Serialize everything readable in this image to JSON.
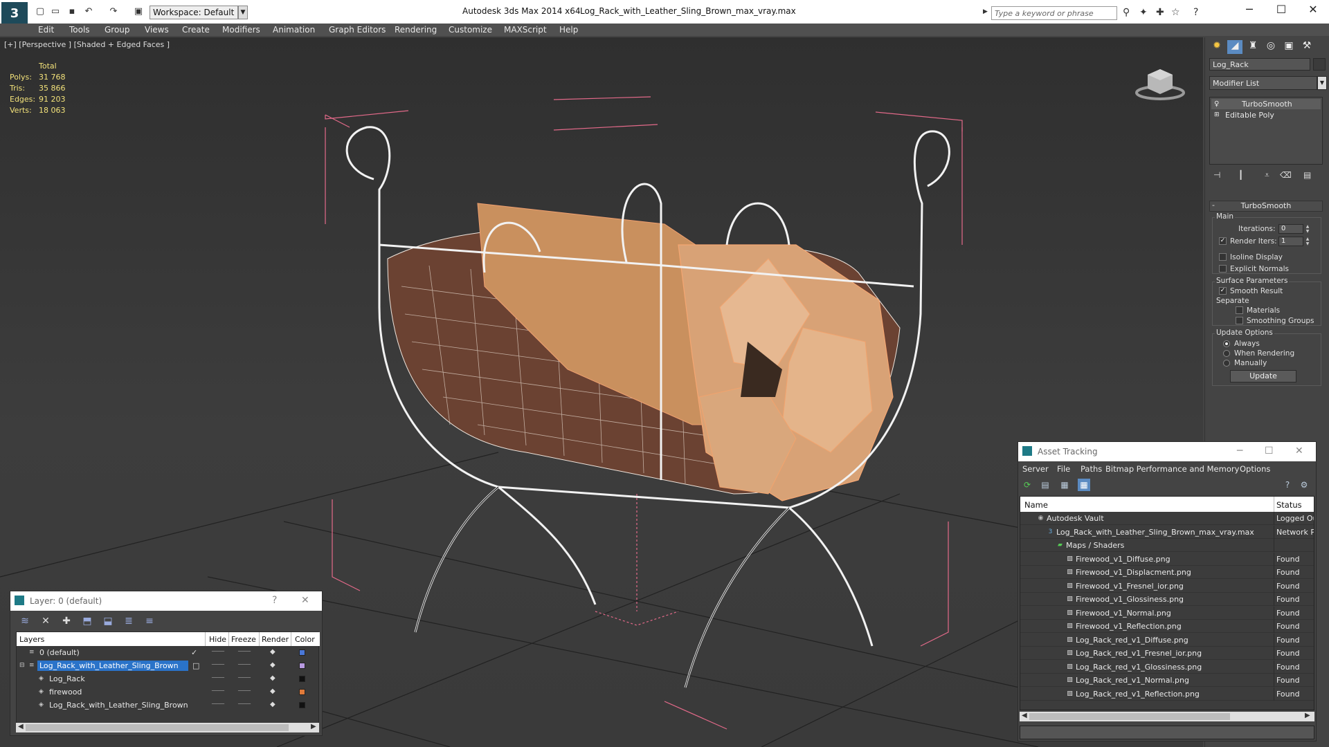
{
  "titlebar": {
    "workspace": "Workspace: Default",
    "app_title": "Autodesk 3ds Max  2014 x64",
    "file_title": "Log_Rack_with_Leather_Sling_Brown_max_vray.max",
    "search_placeholder": "Type a keyword or phrase"
  },
  "menu": [
    "Edit",
    "Tools",
    "Group",
    "Views",
    "Create",
    "Modifiers",
    "Animation",
    "Graph Editors",
    "Rendering",
    "Customize",
    "MAXScript",
    "Help"
  ],
  "viewport": {
    "label": "[+] [Perspective ] [Shaded + Edged Faces ]",
    "stats": {
      "header": "Total",
      "rows": [
        {
          "label": "Polys:",
          "value": "31 768"
        },
        {
          "label": "Tris:",
          "value": "35 866"
        },
        {
          "label": "Edges:",
          "value": "91 203"
        },
        {
          "label": "Verts:",
          "value": "18 063"
        }
      ]
    }
  },
  "command_panel": {
    "object_name": "Log_Rack",
    "modifier_list": "Modifier List",
    "stack": [
      "TurboSmooth",
      "Editable Poly"
    ],
    "rollout_title": "TurboSmooth",
    "main_group": "Main",
    "iterations_label": "Iterations:",
    "iterations_value": "0",
    "render_iters_label": "Render Iters:",
    "render_iters_value": "1",
    "render_iters_checked": true,
    "isoline_label": "Isoline Display",
    "explicit_normals_label": "Explicit Normals",
    "surface_group": "Surface Parameters",
    "smooth_result_label": "Smooth Result",
    "separate_label": "Separate",
    "materials_label": "Materials",
    "smoothing_groups_label": "Smoothing Groups",
    "update_group": "Update Options",
    "always_label": "Always",
    "when_rendering_label": "When Rendering",
    "manually_label": "Manually",
    "update_button": "Update"
  },
  "layer_window": {
    "title": "Layer: 0 (default)",
    "help": "?",
    "headers": {
      "layers": "Layers",
      "hide": "Hide",
      "freeze": "Freeze",
      "render": "Render",
      "color": "Color"
    },
    "rows": [
      {
        "name": "0 (default)",
        "indent": 1,
        "color": "#4a78d8",
        "current": true
      },
      {
        "name": "Log_Rack_with_Leather_Sling_Brown",
        "indent": 1,
        "color": "#b89ae0",
        "selected": true
      },
      {
        "name": "Log_Rack",
        "indent": 2,
        "color": "#111111"
      },
      {
        "name": "firewood",
        "indent": 2,
        "color": "#e07a3a"
      },
      {
        "name": "Log_Rack_with_Leather_Sling_Brown",
        "indent": 2,
        "color": "#111111"
      }
    ]
  },
  "asset_window": {
    "title": "Asset Tracking",
    "menu": [
      "Server",
      "File",
      "Paths",
      "Bitmap Performance and Memory",
      "Options"
    ],
    "headers": {
      "name": "Name",
      "status": "Status"
    },
    "rows": [
      {
        "name": "Autodesk Vault",
        "indent": 1,
        "status": "Logged Ou",
        "icon": "vault-icon"
      },
      {
        "name": "Log_Rack_with_Leather_Sling_Brown_max_vray.max",
        "indent": 2,
        "status": "Network P",
        "icon": "max-file-icon"
      },
      {
        "name": "Maps / Shaders",
        "indent": 3,
        "status": "",
        "icon": "maps-icon"
      },
      {
        "name": "Firewood_v1_Diffuse.png",
        "indent": 4,
        "status": "Found",
        "icon": "bitmap-icon"
      },
      {
        "name": "Firewood_v1_Displacment.png",
        "indent": 4,
        "status": "Found",
        "icon": "bitmap-icon"
      },
      {
        "name": "Firewood_v1_Fresnel_ior.png",
        "indent": 4,
        "status": "Found",
        "icon": "bitmap-icon"
      },
      {
        "name": "Firewood_v1_Glossiness.png",
        "indent": 4,
        "status": "Found",
        "icon": "bitmap-icon"
      },
      {
        "name": "Firewood_v1_Normal.png",
        "indent": 4,
        "status": "Found",
        "icon": "bitmap-icon"
      },
      {
        "name": "Firewood_v1_Reflection.png",
        "indent": 4,
        "status": "Found",
        "icon": "bitmap-icon"
      },
      {
        "name": "Log_Rack_red_v1_Diffuse.png",
        "indent": 4,
        "status": "Found",
        "icon": "bitmap-icon"
      },
      {
        "name": "Log_Rack_red_v1_Fresnel_ior.png",
        "indent": 4,
        "status": "Found",
        "icon": "bitmap-icon"
      },
      {
        "name": "Log_Rack_red_v1_Glossiness.png",
        "indent": 4,
        "status": "Found",
        "icon": "bitmap-icon"
      },
      {
        "name": "Log_Rack_red_v1_Normal.png",
        "indent": 4,
        "status": "Found",
        "icon": "bitmap-icon"
      },
      {
        "name": "Log_Rack_red_v1_Reflection.png",
        "indent": 4,
        "status": "Found",
        "icon": "bitmap-icon"
      }
    ]
  }
}
